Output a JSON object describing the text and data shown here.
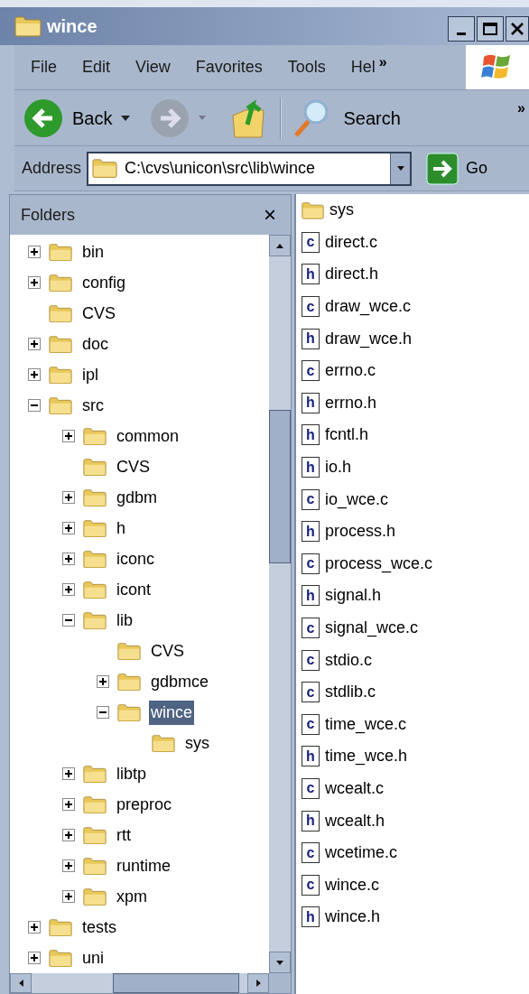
{
  "window": {
    "title": "wince"
  },
  "menu": [
    "File",
    "Edit",
    "View",
    "Favorites",
    "Tools",
    "Hel"
  ],
  "menu_overflow": "»",
  "toolbar": {
    "back": "Back",
    "search": "Search",
    "overflow": "»"
  },
  "address": {
    "label": "Address",
    "value": "C:\\cvs\\unicon\\src\\lib\\wince",
    "go": "Go"
  },
  "folders_pane": {
    "title": "Folders",
    "close": "×",
    "tree": [
      {
        "name": "bin",
        "expanded": false,
        "selected": false
      },
      {
        "name": "config",
        "expanded": false,
        "selected": false
      },
      {
        "name": "CVS",
        "selected": false
      },
      {
        "name": "doc",
        "expanded": false,
        "selected": false
      },
      {
        "name": "ipl",
        "expanded": false,
        "selected": false
      },
      {
        "name": "src",
        "expanded": true,
        "selected": false,
        "children": [
          {
            "name": "common",
            "expanded": false,
            "selected": false
          },
          {
            "name": "CVS",
            "selected": false
          },
          {
            "name": "gdbm",
            "expanded": false,
            "selected": false
          },
          {
            "name": "h",
            "expanded": false,
            "selected": false
          },
          {
            "name": "iconc",
            "expanded": false,
            "selected": false
          },
          {
            "name": "icont",
            "expanded": false,
            "selected": false
          },
          {
            "name": "lib",
            "expanded": true,
            "selected": false,
            "children": [
              {
                "name": "CVS",
                "selected": false
              },
              {
                "name": "gdbmce",
                "expanded": false,
                "selected": false
              },
              {
                "name": "wince",
                "expanded": true,
                "selected": true,
                "children": [
                  {
                    "name": "sys",
                    "selected": false
                  }
                ]
              }
            ]
          },
          {
            "name": "libtp",
            "expanded": false,
            "selected": false
          },
          {
            "name": "preproc",
            "expanded": false,
            "selected": false
          },
          {
            "name": "rtt",
            "expanded": false,
            "selected": false
          },
          {
            "name": "runtime",
            "expanded": false,
            "selected": false
          },
          {
            "name": "xpm",
            "expanded": false,
            "selected": false
          }
        ]
      },
      {
        "name": "tests",
        "expanded": false,
        "selected": false
      },
      {
        "name": "uni",
        "expanded": false,
        "selected": false
      }
    ]
  },
  "files": [
    {
      "name": "sys",
      "kind": "folder"
    },
    {
      "name": "direct.c",
      "kind": "file",
      "badge": "c"
    },
    {
      "name": "direct.h",
      "kind": "file",
      "badge": "h"
    },
    {
      "name": "draw_wce.c",
      "kind": "file",
      "badge": "c"
    },
    {
      "name": "draw_wce.h",
      "kind": "file",
      "badge": "h"
    },
    {
      "name": "errno.c",
      "kind": "file",
      "badge": "c"
    },
    {
      "name": "errno.h",
      "kind": "file",
      "badge": "h"
    },
    {
      "name": "fcntl.h",
      "kind": "file",
      "badge": "h"
    },
    {
      "name": "io.h",
      "kind": "file",
      "badge": "h"
    },
    {
      "name": "io_wce.c",
      "kind": "file",
      "badge": "c"
    },
    {
      "name": "process.h",
      "kind": "file",
      "badge": "h"
    },
    {
      "name": "process_wce.c",
      "kind": "file",
      "badge": "c"
    },
    {
      "name": "signal.h",
      "kind": "file",
      "badge": "h"
    },
    {
      "name": "signal_wce.c",
      "kind": "file",
      "badge": "c"
    },
    {
      "name": "stdio.c",
      "kind": "file",
      "badge": "c"
    },
    {
      "name": "stdlib.c",
      "kind": "file",
      "badge": "c"
    },
    {
      "name": "time_wce.c",
      "kind": "file",
      "badge": "c"
    },
    {
      "name": "time_wce.h",
      "kind": "file",
      "badge": "h"
    },
    {
      "name": "wcealt.c",
      "kind": "file",
      "badge": "c"
    },
    {
      "name": "wcealt.h",
      "kind": "file",
      "badge": "h"
    },
    {
      "name": "wcetime.c",
      "kind": "file",
      "badge": "c"
    },
    {
      "name": "wince.c",
      "kind": "file",
      "badge": "c"
    },
    {
      "name": "wince.h",
      "kind": "file",
      "badge": "h"
    }
  ]
}
